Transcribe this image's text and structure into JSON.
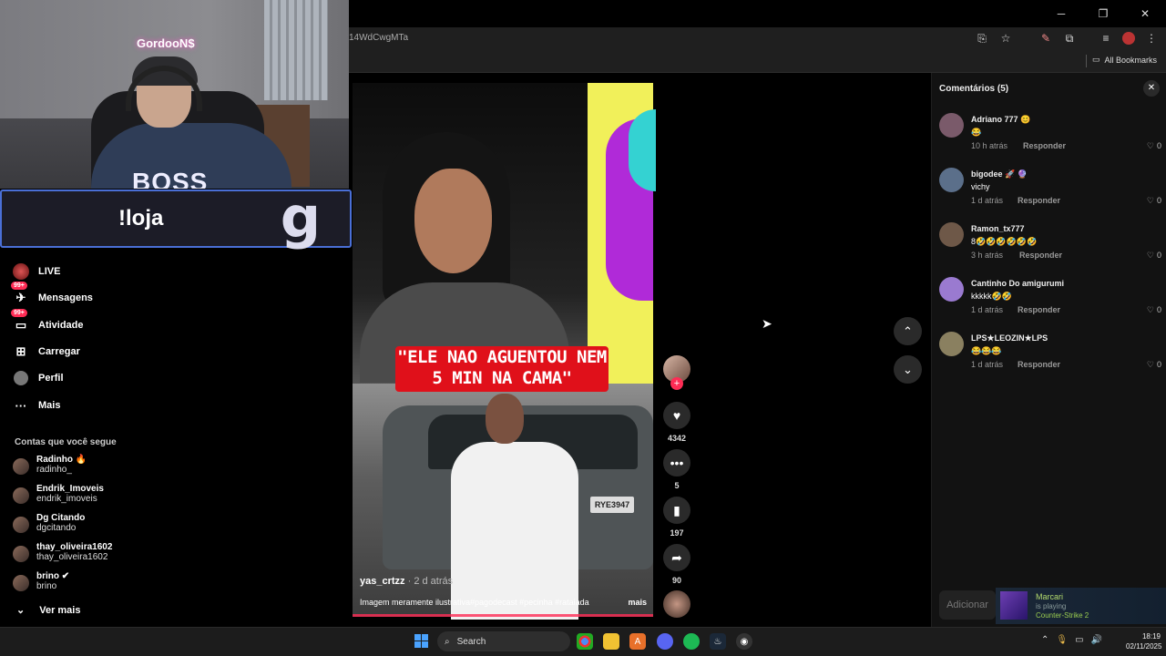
{
  "browser": {
    "url": "14WdCwgMTa",
    "bookmarks_label": "All Bookmarks",
    "window_controls": [
      "─",
      "❐",
      "✕"
    ]
  },
  "webcam": {
    "streamer_name": "GordooN$",
    "shirt_text": "BOSS",
    "banner_text": "!loja",
    "banner_logo": "g"
  },
  "nav": {
    "items": [
      {
        "label": "LIVE",
        "icon": "live-avatar-icon"
      },
      {
        "label": "Mensagens",
        "icon": "message-icon",
        "badge": "99+"
      },
      {
        "label": "Atividade",
        "icon": "activity-icon",
        "badge": "99+"
      },
      {
        "label": "Carregar",
        "icon": "upload-icon"
      },
      {
        "label": "Perfil",
        "icon": "profile-icon"
      },
      {
        "label": "Mais",
        "icon": "more-icon"
      }
    ],
    "following_title": "Contas que você segue",
    "following": [
      {
        "name": "Radinho 🔥",
        "handle": "radinho_"
      },
      {
        "name": "Endrik_Imoveis",
        "handle": "endrik_imoveis"
      },
      {
        "name": "Dg Citando",
        "handle": "dgcitando"
      },
      {
        "name": "thay_oliveira1602",
        "handle": "thay_oliveira1602"
      },
      {
        "name": "brino ✔",
        "handle": "brino"
      }
    ],
    "see_more": "Ver mais"
  },
  "video": {
    "caption": "\"ELE NAO AGUENTOU NEM 5 MIN NA CAMA\"",
    "author": "yas_crtzz",
    "time": "· 2 d atrás",
    "description": "Imagem meramente ilustrativa#pagodecast #pecinha #rataiada",
    "more": "mais",
    "plate": "RYE3947"
  },
  "actions": {
    "likes": "4342",
    "comments": "5",
    "saves": "197",
    "shares": "90"
  },
  "comments": {
    "title": "Comentários (5)",
    "reply_label": "Responder",
    "items": [
      {
        "name": "Adriano 777 😊",
        "text": "😂",
        "time": "10 h atrás",
        "likes": "0",
        "color": "#7a5a6a"
      },
      {
        "name": "bigodee 🚀 🔮",
        "text": "vichy",
        "time": "1 d atrás",
        "likes": "0",
        "color": "#5b6f8a"
      },
      {
        "name": "Ramon_tx777",
        "text": "8🤣🤣🤣🤣🤣🤣",
        "time": "3 h atrás",
        "likes": "0",
        "color": "#6e5848"
      },
      {
        "name": "Cantinho Do amigurumi",
        "text": "kkkkk🤣🤣",
        "time": "1 d atrás",
        "likes": "0",
        "color": "#9a7ad0"
      },
      {
        "name": "LPS★LEOZIN★LPS",
        "text": "😂😂😂",
        "time": "1 d atrás",
        "likes": "0",
        "color": "#8a8060"
      }
    ],
    "add_placeholder": "Adicionar"
  },
  "steam": {
    "name": "Marcari",
    "status": "is playing",
    "game": "Counter-Strike 2"
  },
  "taskbar": {
    "search": "Search",
    "time": "18:19",
    "date": "02/11/2025"
  }
}
